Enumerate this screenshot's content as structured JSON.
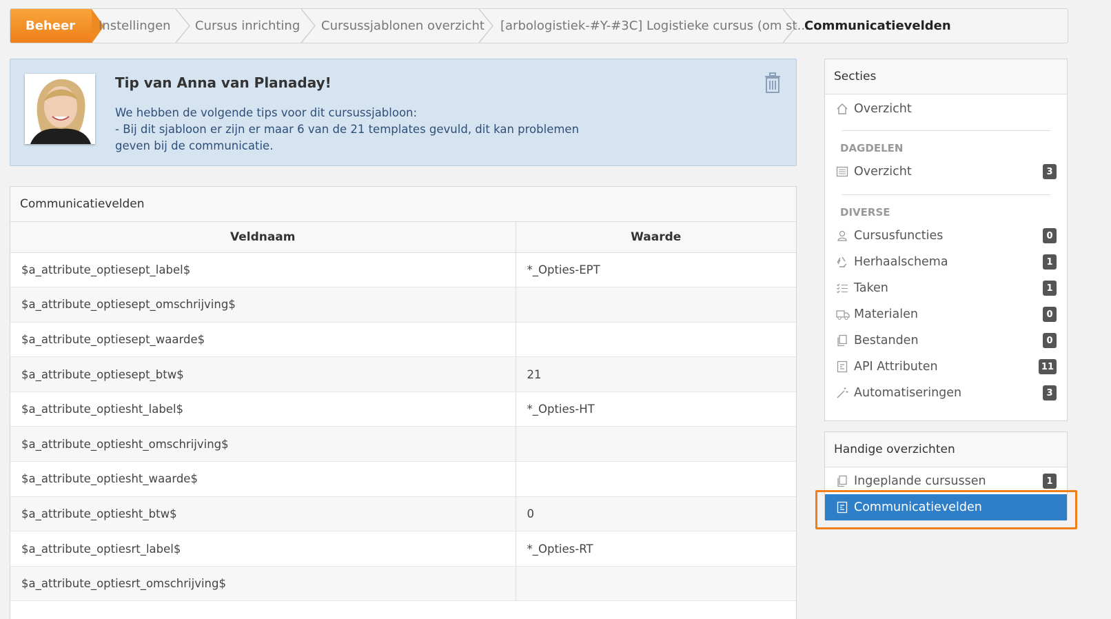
{
  "breadcrumb": {
    "items": [
      "Beheer",
      "Instellingen",
      "Cursus inrichting",
      "Cursussjablonen overzicht",
      "[arbologistiek-#Y-#3C] Logistieke cursus (om st...",
      "Communicatievelden"
    ]
  },
  "tip": {
    "title": "Tip van Anna van Planaday!",
    "line1": "We hebben de volgende tips voor dit cursussjabloon:",
    "line2": "- Bij dit sjabloon er zijn er maar 6 van de 21 templates gevuld, dit kan problemen",
    "line3": "geven bij de communicatie.",
    "trash_icon": "trash-icon"
  },
  "fields_panel": {
    "title": "Communicatievelden",
    "columns": [
      "Veldnaam",
      "Waarde"
    ],
    "rows": [
      [
        "$a_attribute_optiesept_label$",
        "*_Opties-EPT"
      ],
      [
        "$a_attribute_optiesept_omschrijving$",
        ""
      ],
      [
        "$a_attribute_optiesept_waarde$",
        ""
      ],
      [
        "$a_attribute_optiesept_btw$",
        "21"
      ],
      [
        "$a_attribute_optiesht_label$",
        "*_Opties-HT"
      ],
      [
        "$a_attribute_optiesht_omschrijving$",
        ""
      ],
      [
        "$a_attribute_optiesht_waarde$",
        ""
      ],
      [
        "$a_attribute_optiesht_btw$",
        "0"
      ],
      [
        "$a_attribute_optiesrt_label$",
        "*_Opties-RT"
      ],
      [
        "$a_attribute_optiesrt_omschrijving$",
        ""
      ]
    ]
  },
  "sections": {
    "title": "Secties",
    "overview": "Overzicht",
    "dagdelen": {
      "heading": "DAGDELEN",
      "overview": "Overzicht",
      "overview_count": "3"
    },
    "diverse": {
      "heading": "DIVERSE",
      "items": [
        {
          "label": "Cursusfuncties",
          "count": "0",
          "icon": "user-icon"
        },
        {
          "label": "Herhaalschema",
          "count": "1",
          "icon": "recycle-icon"
        },
        {
          "label": "Taken",
          "count": "1",
          "icon": "checklist-icon"
        },
        {
          "label": "Materialen",
          "count": "0",
          "icon": "truck-icon"
        },
        {
          "label": "Bestanden",
          "count": "0",
          "icon": "files-icon"
        },
        {
          "label": "API Attributen",
          "count": "11",
          "icon": "api-icon"
        },
        {
          "label": "Automatiseringen",
          "count": "3",
          "icon": "magic-wand-icon"
        }
      ]
    }
  },
  "handy": {
    "title": "Handige overzichten",
    "items": [
      {
        "label": "Ingeplande cursussen",
        "count": "1"
      },
      {
        "label": "Communicatievelden",
        "count": ""
      }
    ]
  },
  "colors": {
    "accent_orange": "#ef7f1a",
    "active_blue": "#2f7fc8",
    "tip_background": "#d6e4f2"
  }
}
